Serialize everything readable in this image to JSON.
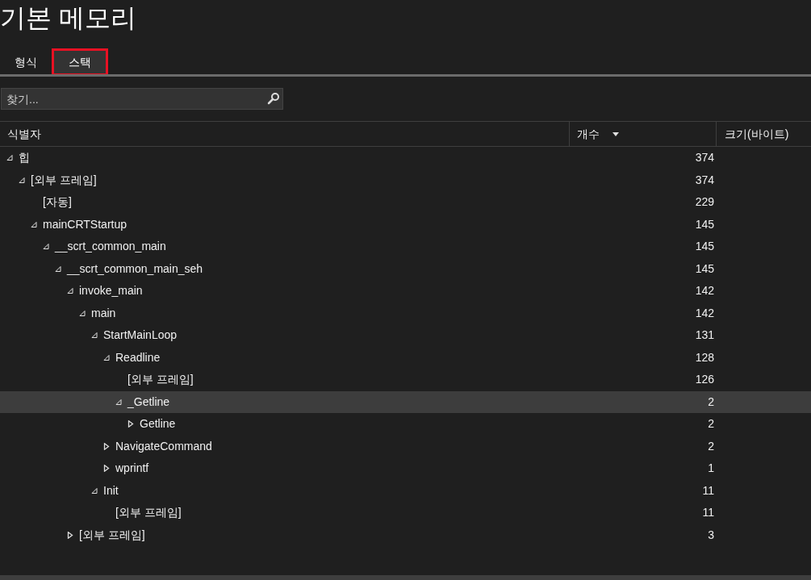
{
  "title": "기본 메모리",
  "tabs": [
    {
      "label": "형식",
      "selected": false
    },
    {
      "label": "스택",
      "selected": true
    }
  ],
  "search": {
    "placeholder": "찾기..."
  },
  "table": {
    "columns": [
      {
        "label": "식별자",
        "sorted": false
      },
      {
        "label": "개수",
        "sorted": true
      },
      {
        "label": "크기(바이트)",
        "sorted": false
      }
    ],
    "rows": [
      {
        "name": "힙",
        "count": "374",
        "selected": false,
        "expanded": true,
        "children": [
          {
            "name": "[외부 프레임]",
            "count": "374",
            "selected": false,
            "expanded": true,
            "children": [
              {
                "name": "[자동]",
                "count": "229",
                "selected": false
              },
              {
                "name": "mainCRTStartup",
                "count": "145",
                "selected": false,
                "expanded": true,
                "children": [
                  {
                    "name": "__scrt_common_main",
                    "count": "145",
                    "selected": false,
                    "expanded": true,
                    "children": [
                      {
                        "name": "__scrt_common_main_seh",
                        "count": "145",
                        "selected": false,
                        "expanded": true,
                        "children": [
                          {
                            "name": "invoke_main",
                            "count": "142",
                            "selected": false,
                            "expanded": true,
                            "children": [
                              {
                                "name": "main",
                                "count": "142",
                                "selected": false,
                                "expanded": true,
                                "children": [
                                  {
                                    "name": "StartMainLoop",
                                    "count": "131",
                                    "selected": false,
                                    "expanded": true,
                                    "children": [
                                      {
                                        "name": "Readline",
                                        "count": "128",
                                        "selected": false,
                                        "expanded": true,
                                        "children": [
                                          {
                                            "name": "[외부 프레임]",
                                            "count": "126",
                                            "selected": false
                                          },
                                          {
                                            "name": "_Getline",
                                            "count": "2",
                                            "selected": true,
                                            "expanded": true,
                                            "children": [
                                              {
                                                "name": "Getline",
                                                "count": "2",
                                                "selected": false,
                                                "expanded": false
                                              }
                                            ]
                                          }
                                        ]
                                      },
                                      {
                                        "name": "NavigateCommand",
                                        "count": "2",
                                        "selected": false,
                                        "expanded": false
                                      },
                                      {
                                        "name": "wprintf",
                                        "count": "1",
                                        "selected": false,
                                        "expanded": false
                                      }
                                    ]
                                  },
                                  {
                                    "name": "Init",
                                    "count": "11",
                                    "selected": false,
                                    "expanded": true,
                                    "children": [
                                      {
                                        "name": "[외부 프레임]",
                                        "count": "11",
                                        "selected": false
                                      }
                                    ]
                                  }
                                ]
                              }
                            ]
                          },
                          {
                            "name": "[외부 프레임]",
                            "count": "3",
                            "selected": false,
                            "expanded": false
                          }
                        ]
                      }
                    ]
                  }
                ]
              }
            ]
          }
        ]
      }
    ]
  }
}
